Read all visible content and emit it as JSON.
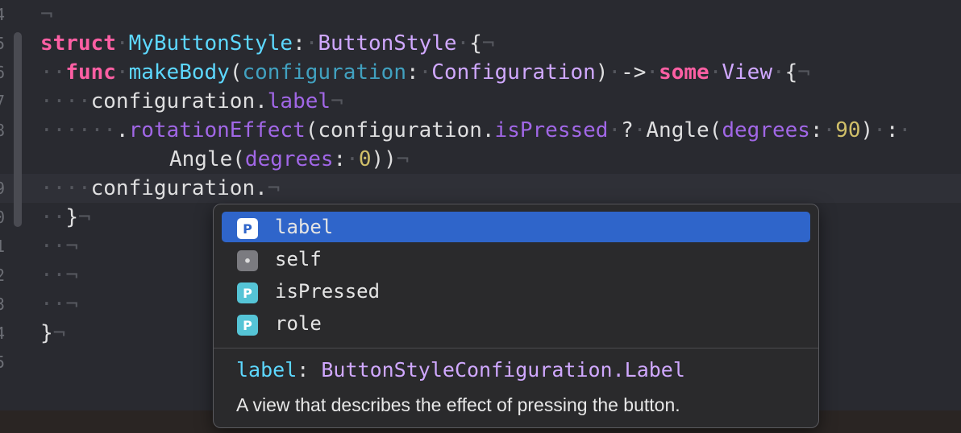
{
  "line_numbers": [
    "4",
    "5",
    "6",
    "7",
    "8",
    "9",
    "0",
    "1",
    "2",
    "3",
    "4",
    "5"
  ],
  "code": {
    "l4": {
      "ret": "¬"
    },
    "l5": {
      "struct": "struct",
      "name": "MyButtonStyle",
      "colon": ":",
      "proto": "ButtonStyle",
      "brace": "{",
      "ret": "¬"
    },
    "l6": {
      "ind": "··",
      "func": "func",
      "name": "makeBody",
      "open": "(",
      "param": "configuration",
      "colon": ":",
      "type": "Configuration",
      "close": ")",
      "arrow": "->",
      "some": "some",
      "view": "View",
      "brace": "{",
      "ret": "¬"
    },
    "l7": {
      "ind": "····",
      "obj": "configuration.",
      "prop": "label",
      "ret": "¬"
    },
    "l8": {
      "ind": "······",
      "dot": ".",
      "method": "rotationEffect",
      "open": "(configuration.",
      "prop": "isPressed",
      "q": "?",
      "angle": "Angle(",
      "arg": "degrees",
      "colon": ":",
      "val": "90",
      "close": ")",
      "tern": ":"
    },
    "l8b": {
      "angle": "Angle(",
      "arg": "degrees",
      "colon": ":",
      "val": "0",
      "close": "))",
      "ret": "¬"
    },
    "l9": {
      "ind": "····",
      "text": "configuration.",
      "ret": "¬"
    },
    "l10": {
      "ind": "··",
      "brace": "}",
      "ret": "¬"
    },
    "l11": {
      "ind": "··",
      "ret": "¬"
    },
    "l12": {
      "ind": "··",
      "ret": "¬"
    },
    "l13": {
      "ind": "··",
      "ret": "¬"
    },
    "l14": {
      "brace": "}",
      "ret": "¬"
    }
  },
  "completion": {
    "items": [
      {
        "badge": "P",
        "label": "label",
        "selected": true
      },
      {
        "badge": "•",
        "label": "self",
        "selected": false
      },
      {
        "badge": "P",
        "label": "isPressed",
        "selected": false
      },
      {
        "badge": "P",
        "label": "role",
        "selected": false
      }
    ],
    "signature": {
      "name": "label",
      "colon": ": ",
      "type": "ButtonStyleConfiguration.Label"
    },
    "description": "A view that describes the effect of pressing the button."
  },
  "colors": {
    "background": "#292a30",
    "keyword": "#fc5fa3",
    "type": "#d0a8ff",
    "declaration": "#5dd8ff",
    "selection": "#2f65ca"
  }
}
